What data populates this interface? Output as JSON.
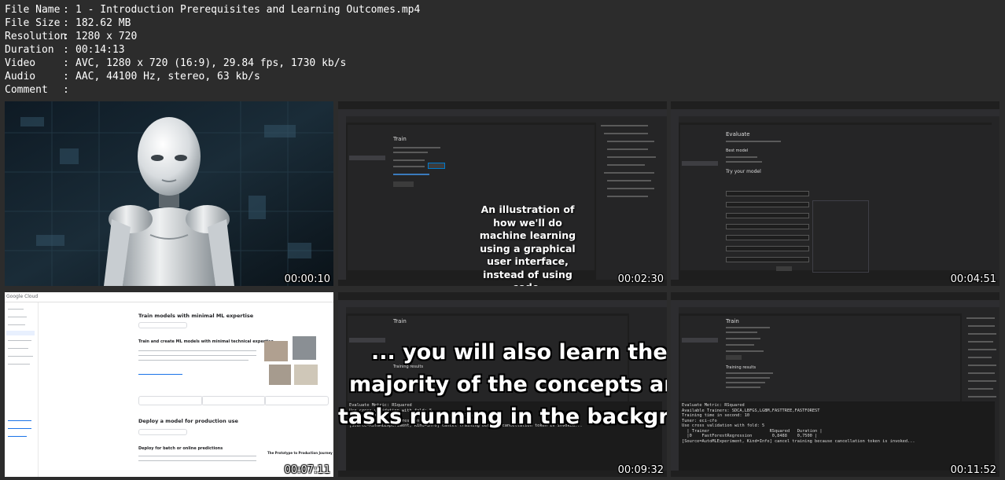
{
  "file_info": [
    {
      "key": "File Name",
      "value": "1 - Introduction Prerequisites and Learning Outcomes.mp4"
    },
    {
      "key": "File Size",
      "value": "182.62 MB"
    },
    {
      "key": "Resolution",
      "value": "1280 x 720"
    },
    {
      "key": "Duration",
      "value": "00:14:13"
    },
    {
      "key": "Video",
      "value": "AVC, 1280 x 720 (16:9), 29.84 fps, 1730 kb/s"
    },
    {
      "key": "Audio",
      "value": "AAC, 44100 Hz, stereo, 63 kb/s"
    },
    {
      "key": "Comment",
      "value": ""
    }
  ],
  "separator": ":",
  "thumbnails": [
    {
      "timestamp": "00:00:10"
    },
    {
      "timestamp": "00:02:30",
      "caption": "An illustration of how we'll do machine learning using a graphical user interface, instead of using code.",
      "panel_title": "Train"
    },
    {
      "timestamp": "00:04:51",
      "panel_title": "Evaluate",
      "sub_title": "Try your model",
      "best_model": "Best model"
    },
    {
      "timestamp": "00:07:11",
      "header": "Google Cloud",
      "heading1": "Train models with minimal ML expertise",
      "heading2": "Train and create ML models with minimal technical expertise",
      "heading3": "Deploy a model for production use",
      "sub3": "Deploy for batch or online predictions",
      "side_heading": "The Prototype to Production Journey"
    },
    {
      "timestamp": "00:09:32",
      "caption_lines": [
        "... you will also learn the",
        "majority of the concepts and",
        "tasks running in the backgroud!"
      ],
      "panel_title": "Train",
      "results": "Training results",
      "output_lines": [
        "Evaluate Metric: RSquared",
        "Use cross validation with fold: 5",
        "  | Trainer                        RSquared   Duration |",
        "  |0    FastForestRegression        0,8488    0,7500 |",
        "[Source=AutoMLExperiment, Kind=Info] cancel training because cancellation token is invoked..."
      ]
    },
    {
      "timestamp": "00:11:52",
      "panel_title": "Train",
      "results": "Training results",
      "output_lines": [
        "Evaluate Metric: RSquared",
        "Available Trainers: SDCA,LBFGS,LGBM,FASTTREE,FASTFOREST",
        "Training time in second: 10",
        "Tuner: eci-cfo",
        "Use cross validation with fold: 5",
        "  | Trainer                        RSquared   Duration |",
        "  |0    FastForestRegression        0,8488    0,7500 |",
        "[Source=AutoMLExperiment, Kind=Info] cancel training because cancellation token is invoked..."
      ]
    }
  ]
}
